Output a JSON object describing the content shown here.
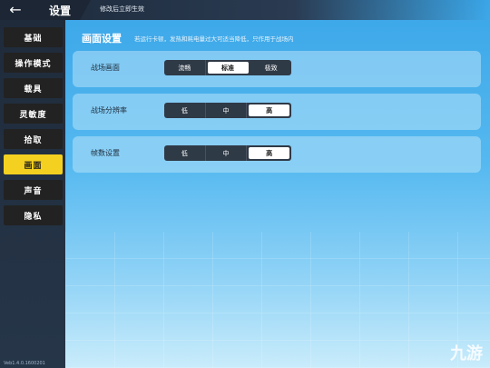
{
  "header": {
    "back_icon": "←",
    "title": "设置",
    "hint": "修改后立即生效"
  },
  "sidebar": {
    "items": [
      {
        "label": "基础"
      },
      {
        "label": "操作模式"
      },
      {
        "label": "载具"
      },
      {
        "label": "灵敏度"
      },
      {
        "label": "拾取"
      },
      {
        "label": "画面"
      },
      {
        "label": "声音"
      },
      {
        "label": "隐私"
      }
    ],
    "active_index": 5,
    "version": "Veb1.4.0.1600201"
  },
  "panel": {
    "title": "画面设置",
    "description": "若运行卡顿，发热和耗电量过大可适当降低，只作用于战场内"
  },
  "settings": [
    {
      "label": "战场画面",
      "options": [
        "流畅",
        "标准",
        "极致"
      ],
      "selected": "标准"
    },
    {
      "label": "战场分辨率",
      "options": [
        "低",
        "中",
        "高"
      ],
      "selected": "高"
    },
    {
      "label": "帧数设置",
      "options": [
        "低",
        "中",
        "高"
      ],
      "selected": "高"
    }
  ],
  "watermark": "九游",
  "colors": {
    "active_tab": "#f4d020",
    "sidebar_bg": "#1f2b3b",
    "accent_blue": "#3aa6e8"
  }
}
